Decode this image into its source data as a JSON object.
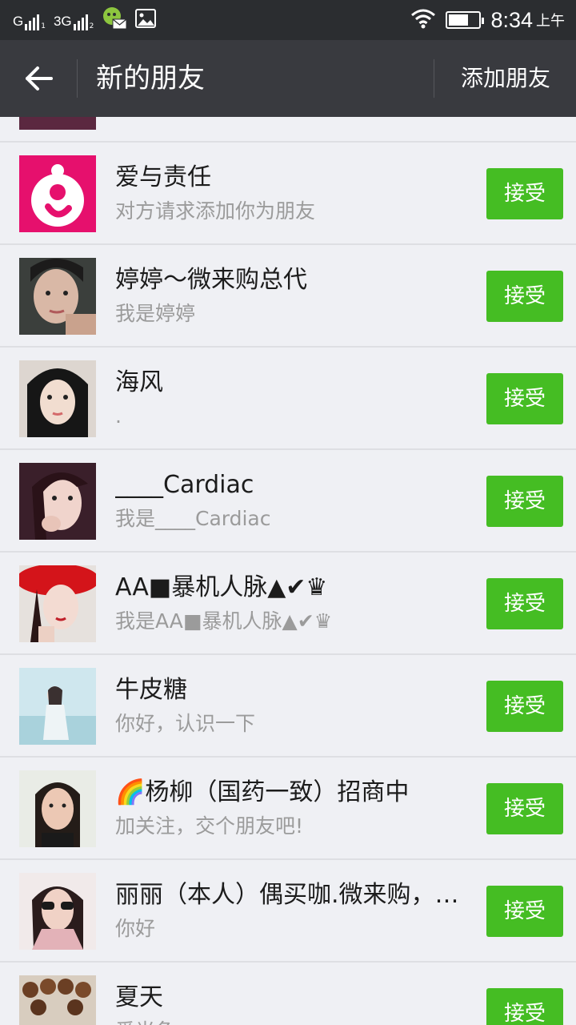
{
  "status_bar": {
    "signal1_label": "G",
    "signal1_sub": "1",
    "signal2_label": "3G",
    "signal2_sub": "2",
    "time": "8:34",
    "ampm": "上午",
    "icons": [
      "signal-icon",
      "signal-3g-icon",
      "wechat-mail-icon",
      "image-icon",
      "wifi-icon",
      "battery-icon"
    ]
  },
  "header": {
    "back_icon": "arrow-left-icon",
    "title": "新的朋友",
    "action_label": "添加朋友"
  },
  "requests": [
    {
      "name": "",
      "message": "",
      "accept_label": ""
    },
    {
      "name": "爱与责任",
      "message": "对方请求添加你为朋友",
      "accept_label": "接受"
    },
    {
      "name": "婷婷～微来购总代",
      "message": "我是婷婷",
      "accept_label": "接受"
    },
    {
      "name": "海风",
      "message": ".",
      "accept_label": "接受"
    },
    {
      "name": "____Cardiac",
      "message": "我是____Cardiac",
      "accept_label": "接受"
    },
    {
      "name": "AA■暴机人脉▲✔♛",
      "message": "我是AA■暴机人脉▲✔♛",
      "accept_label": "接受"
    },
    {
      "name": "牛皮糖",
      "message": "你好，认识一下",
      "accept_label": "接受"
    },
    {
      "name": "🌈杨柳（国药一致）招商中",
      "message": "加关注，交个朋友吧!",
      "accept_label": "接受"
    },
    {
      "name": "丽丽（本人）偶买咖.微来购，…",
      "message": "你好",
      "accept_label": "接受"
    },
    {
      "name": "夏天",
      "message": "爱光争",
      "accept_label": "接受"
    }
  ],
  "colors": {
    "status_bar": "#2b2d30",
    "title_bar": "#393a3f",
    "accept_button": "#45bd23",
    "background": "#eff0f4"
  }
}
